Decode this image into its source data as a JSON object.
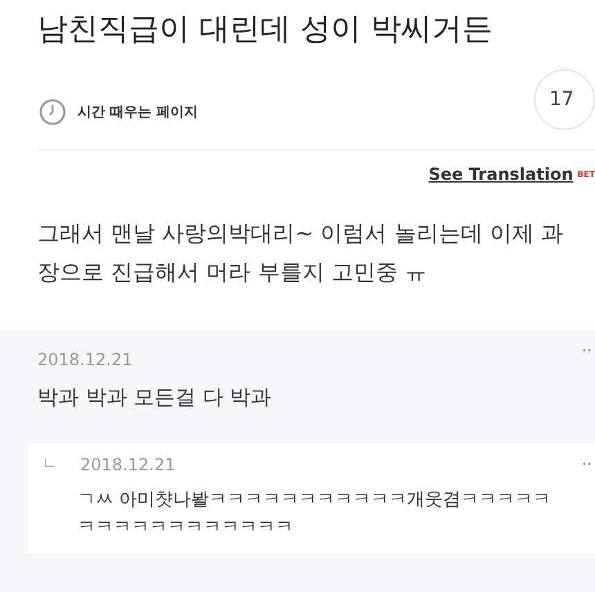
{
  "post": {
    "title": "남친직급이 대린데 성이 박씨거든",
    "author": "시간 때우는 페이지",
    "count": "17",
    "translate": {
      "label": "See Translation",
      "badge": "BET"
    },
    "body": "그래서 맨날 사랑의박대리~ 이럼서 놀리는데 이제 과장으로 진급해서 머라 부를지 고민중 ㅠ"
  },
  "comments": [
    {
      "kind": "comment",
      "date": "2018.12.21",
      "text": "박과 박과 모든걸 다 박과",
      "more": ".."
    },
    {
      "kind": "reply",
      "date": "2018.12.21",
      "text": "ㄱㅆ 아미챳나봘ㅋㅋㅋㅋㅋㅋㅋㅋㅋㅋㅋ개웃겸ㅋㅋㅋㅋㅋㅋㅋㅋㅋㅋㅋㅋㅋㅋㅋㅋㅋ",
      "more": "..",
      "reply_mark": "ㄴ"
    }
  ]
}
